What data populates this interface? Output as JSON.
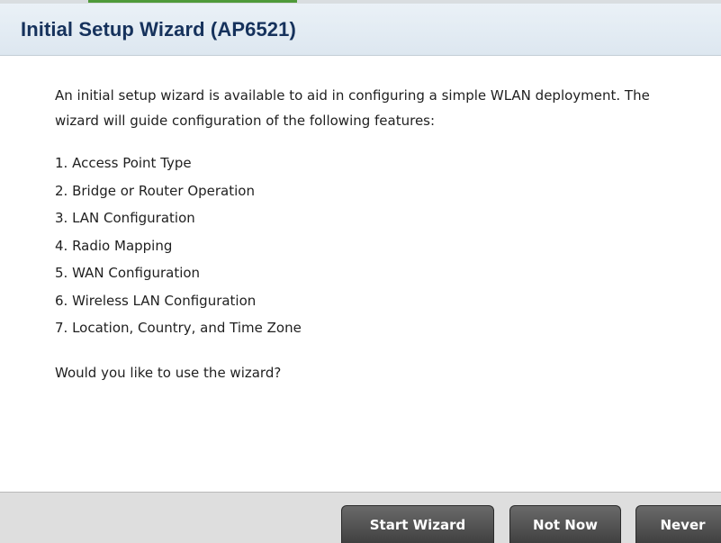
{
  "dialog": {
    "title": "Initial Setup Wizard (AP6521)"
  },
  "content": {
    "intro": "An initial setup wizard is available to aid in configuring a simple WLAN deployment.  The wizard will guide configuration of the following features:",
    "features": [
      "1. Access Point Type",
      "2. Bridge or Router Operation",
      "3. LAN Configuration",
      "4. Radio Mapping",
      "5. WAN Configuration",
      "6. Wireless LAN Configuration",
      "7. Location, Country, and Time Zone"
    ],
    "question": "Would you like to use the wizard?"
  },
  "buttons": {
    "start": "Start Wizard",
    "not_now": "Not Now",
    "never": "Never"
  },
  "colors": {
    "title_text": "#16325c",
    "header_background": "#e4ecf4",
    "button_background": "#4a4a4a",
    "footer_background": "#dedede"
  }
}
